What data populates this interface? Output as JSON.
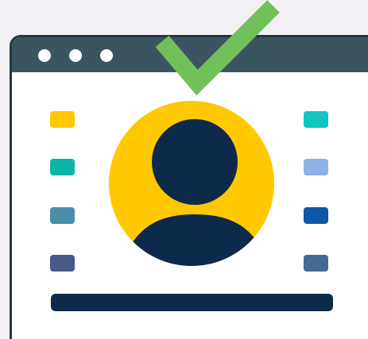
{
  "window": {
    "titlebar_dots": [
      "dot-1",
      "dot-2",
      "dot-3"
    ]
  },
  "colors": {
    "background": "#f3f1f6",
    "window_border": "#27343c",
    "titlebar": "#3b5560",
    "window_body": "#ffffff",
    "avatar_circle": "#ffc800",
    "avatar_figure": "#0d2a4b",
    "checkmark": "#72c05a",
    "bottom_bar": "#0d2a4b"
  },
  "icons": [
    "avatar-icon",
    "checkmark-icon"
  ],
  "left_tiles": [
    {
      "color": "#ffc800"
    },
    {
      "color": "#0ab5a7"
    },
    {
      "color": "#4a8fa8"
    },
    {
      "color": "#455a88"
    }
  ],
  "right_tiles": [
    {
      "color": "#11c6c1"
    },
    {
      "color": "#8cb2e6"
    },
    {
      "color": "#0f57a7"
    },
    {
      "color": "#456a91"
    }
  ]
}
